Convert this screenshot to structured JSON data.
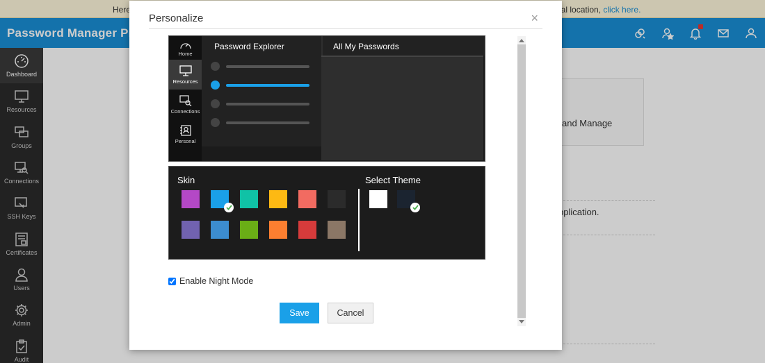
{
  "notice": {
    "left_text": "Here",
    "right_text": "xternal location,",
    "link": "click here."
  },
  "app": {
    "brand": "Password Manager Pro"
  },
  "topbar": {
    "icons": [
      "link-settings-icon",
      "user-star-icon",
      "bell-icon",
      "mail-icon",
      "user-menu-icon"
    ]
  },
  "sidebar": {
    "items": [
      {
        "label": "Dashboard",
        "icon": "dashboard-icon",
        "active": true
      },
      {
        "label": "Resources",
        "icon": "monitor-icon"
      },
      {
        "label": "Groups",
        "icon": "groups-icon"
      },
      {
        "label": "Connections",
        "icon": "connections-icon"
      },
      {
        "label": "SSH Keys",
        "icon": "ssh-key-icon"
      },
      {
        "label": "Certificates",
        "icon": "certificate-icon"
      },
      {
        "label": "Users",
        "icon": "user-icon"
      },
      {
        "label": "Admin",
        "icon": "gear-icon"
      },
      {
        "label": "Audit",
        "icon": "clipboard-icon"
      }
    ]
  },
  "background": {
    "card_text": "and Manage",
    "body_text": "pplication."
  },
  "modal": {
    "title": "Personalize",
    "close_glyph": "×",
    "preview": {
      "nav": [
        {
          "label": "Home",
          "icon": "home-dashboard-icon"
        },
        {
          "label": "Resources",
          "icon": "monitor-icon",
          "active": true
        },
        {
          "label": "Connections",
          "icon": "connections-icon"
        },
        {
          "label": "Personal",
          "icon": "personal-contact-icon"
        }
      ],
      "tab1": "Password Explorer",
      "tab2": "All My Passwords",
      "rows_active_index": 1
    },
    "skin": {
      "title": "Skin",
      "colors": [
        "#b448c6",
        "#1aa0e8",
        "#10c2a6",
        "#fdb913",
        "#f26b61",
        "#2b2b2b",
        "#7162b0",
        "#3c8dd0",
        "#6aae16",
        "#fd7f30",
        "#d63b3b",
        "#8b7766"
      ],
      "selected_index": 1
    },
    "theme": {
      "title": "Select Theme",
      "colors": [
        "#ffffff",
        "#1b2430"
      ],
      "selected_index": 1
    },
    "night_mode_label": "Enable Night Mode",
    "night_mode_checked": true,
    "save_label": "Save",
    "cancel_label": "Cancel"
  }
}
